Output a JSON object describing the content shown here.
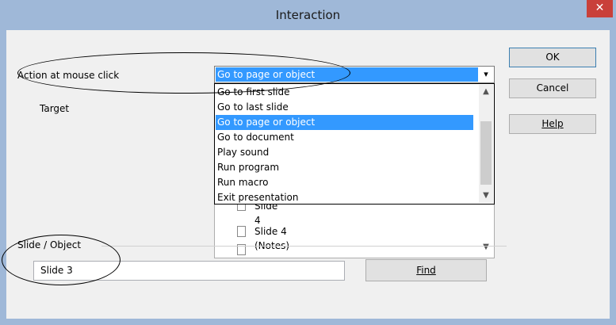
{
  "window": {
    "title": "Interaction",
    "close_glyph": "✕"
  },
  "labels": {
    "action_at_mouse_click": "Action at mouse click",
    "target": "Target",
    "slide_object": "Slide / Object"
  },
  "action_select": {
    "selected": "Go to page or object",
    "arrow": "▾"
  },
  "action_options": [
    "Go to first slide",
    "Go to last slide",
    "Go to page or object",
    "Go to document",
    "Play sound",
    "Run program",
    "Run macro",
    "Exit presentation"
  ],
  "target_tree": {
    "partial_item": "Slide 4",
    "visible_item": "Slide 4 (Notes)"
  },
  "buttons": {
    "ok": "OK",
    "cancel": "Cancel",
    "help": "Help",
    "find": "Find"
  },
  "slide_object_value": "Slide 3",
  "colors": {
    "selection": "#3399ff",
    "title_bar": "#9fb8d8",
    "close": "#c9403a"
  }
}
